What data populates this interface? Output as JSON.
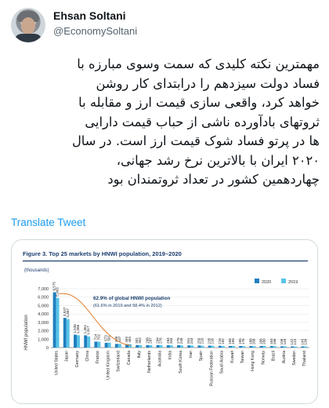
{
  "author": {
    "name": "Ehsan Soltani",
    "handle": "@EconomySoltani"
  },
  "tweet": {
    "lines": [
      "مهمترین نکته کلیدی که سمت وسوی مبارزه با",
      "فساد دولت سیزدهم را درابتدای کار روشن",
      "خواهد کرد، واقعی سازی قیمت ارز و مقابله با",
      "ثروتهای بادآورده ناشی از حباب قیمت دارایی",
      "ها در پرتو فساد شوک قیمت ارز است. در سال",
      "۲۰۲۰ ایران با بالاترین نرخ رشد جهانی،",
      "چهاردهمین کشور در تعداد ثروتمندان بود"
    ]
  },
  "translate_label": "Translate Tweet",
  "chart_data": {
    "type": "bar",
    "title": "Figure 3. Top 25 markets by HNWI population, 2019–2020",
    "unit_label": "(thousands)",
    "ylabel": "HNWI population",
    "yticks": [
      0,
      1000,
      2000,
      3000,
      4000,
      5000,
      6000,
      7000
    ],
    "ytick_labels": [
      "0",
      "1,000",
      "2,000",
      "3,000",
      "4,000",
      "5,000",
      "6,000",
      "7,000"
    ],
    "ylim": [
      0,
      7000
    ],
    "legend": [
      "2020",
      "2019"
    ],
    "legend_position": "top-right",
    "colors": {
      "2020": "#1f7fbf",
      "2019": "#59c3e8",
      "annotation": "#e07b2a"
    },
    "annotation": {
      "main": "62.9% of global HNWI population",
      "sub": "(61.6% in 2019 and 58.4% in 2012)"
    },
    "categories": [
      "United States",
      "Japan",
      "Germany",
      "China",
      "France",
      "United Kingdom",
      "Switzerland",
      "Canada",
      "Italy",
      "Netherlands",
      "Australia",
      "India",
      "South Korea",
      "Iran",
      "Spain",
      "Russian Federation",
      "Saudi Arabia",
      "Kuwait",
      "Taiwan",
      "Hong Kong",
      "Norway",
      "Brazil",
      "Austria",
      "Sweden",
      "Thailand"
    ],
    "series": [
      {
        "name": "2020",
        "values": [
          6575,
          3537,
          1535,
          1461,
          714,
          573,
          438,
          403,
          301,
          298,
          294,
          284,
          278,
          261,
          250,
          235,
          215,
          196,
          195,
          188,
          186,
          184,
          156,
          142,
          140
        ]
      },
      {
        "name": "2019",
        "values": [
          5903,
          3387,
          1466,
          1317,
          702,
          591,
          437,
          403,
          302,
          287,
          276,
          263,
          249,
          243,
          218,
          216,
          192,
          195,
          176,
          168,
          180,
          166,
          149,
          123,
          136
        ]
      }
    ]
  }
}
